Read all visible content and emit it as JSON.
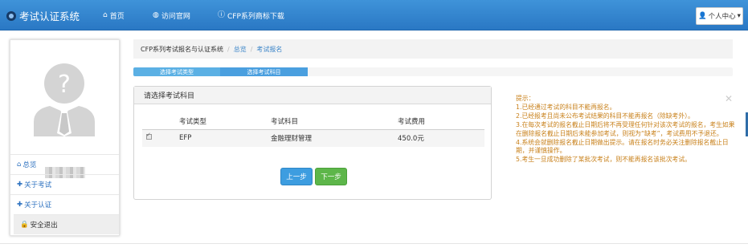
{
  "navbar": {
    "title": "考试认证系统",
    "items": [
      {
        "label": "首页",
        "icon": "home-icon"
      },
      {
        "label": "访问官网",
        "icon": "globe-icon"
      },
      {
        "label": "CFP系列商标下载",
        "icon": "info-icon"
      }
    ],
    "user_menu": "个人中心"
  },
  "sidebar": {
    "items": [
      {
        "label": "总览",
        "icon": "home-icon"
      },
      {
        "label": "关于考试",
        "icon": "plus-icon"
      },
      {
        "label": "关于认证",
        "icon": "plus-icon"
      },
      {
        "label": "安全退出",
        "icon": "lock-icon"
      }
    ]
  },
  "breadcrumb": [
    "CFP系列考试报名与认证系统",
    "总览",
    "考试报名"
  ],
  "steps": [
    "选择考试类型",
    "选择考试科目"
  ],
  "panel": {
    "title": "请选择考试科目",
    "columns": [
      "考试类型",
      "考试科目",
      "考试费用"
    ],
    "rows": [
      {
        "type": "EFP",
        "subject": "金融理财管理",
        "fee": "450.0元"
      }
    ],
    "prev_label": "上一步",
    "next_label": "下一步"
  },
  "tips": {
    "heading": "提示：",
    "lines": [
      "1.已经通过考试的科目不能再报名。",
      "2.已经报考且尚未公布考试结果的科目不能再报名（除缺考外）。",
      "3.在每次考试的报名截止日期后将不再受理任何针对该次考试的报名，考生如果在删除报名截止日期后未能参加考试，则视为“缺考”，考试费用不予退还。",
      "4.系统会就删除报名截止日期做出提示。请在报名时务必关注删除报名截止日期，并谨慎操作。",
      "5.考生一旦成功删除了某批次考试，则不能再报名该批次考试。"
    ]
  },
  "colors": {
    "navbar": "#2f82cd",
    "prev_button": "#3d9de0",
    "next_button": "#5db64a",
    "tips_text": "#c8801a",
    "link": "#3a84c8"
  }
}
